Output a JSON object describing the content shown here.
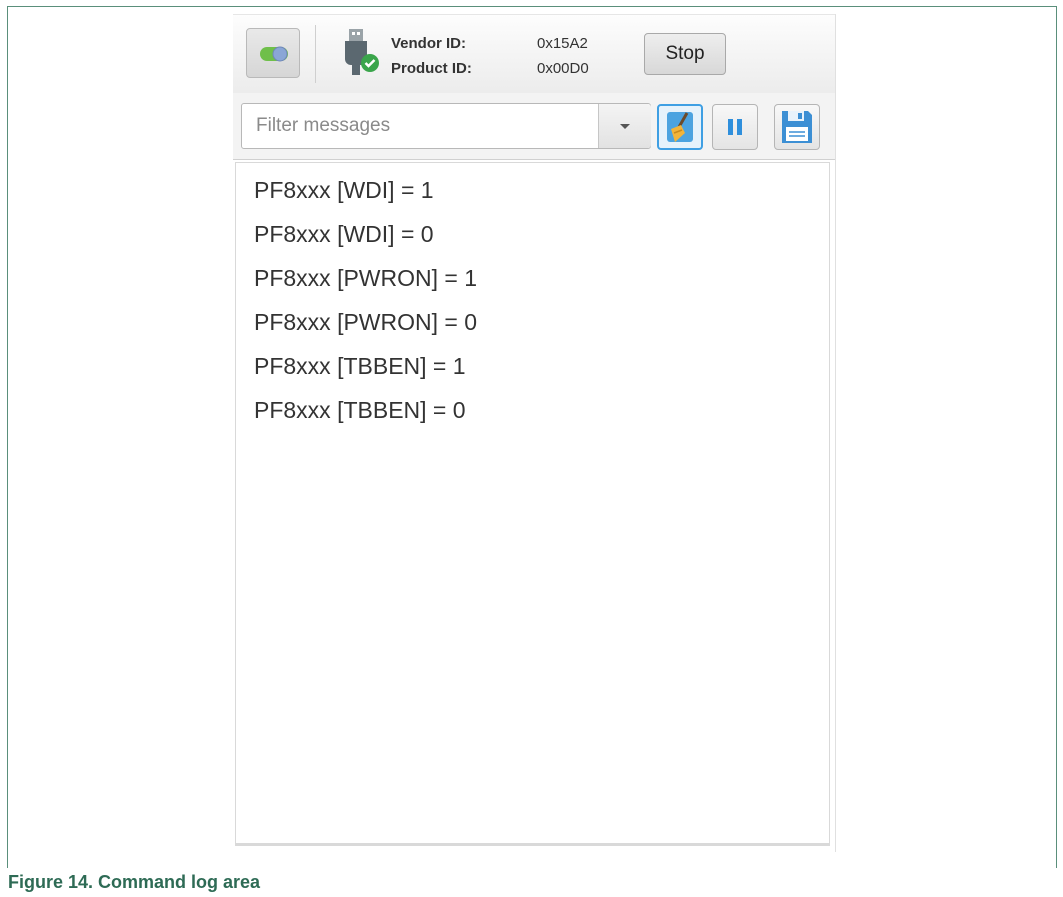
{
  "device": {
    "vendor_label": "Vendor ID:",
    "vendor_value": "0x15A2",
    "product_label": "Product ID:",
    "product_value": "0x00D0",
    "stop_label": "Stop",
    "toggle_icon": "toggle-switch-icon",
    "usb_icon": "usb-connected-icon"
  },
  "filter": {
    "placeholder": "Filter messages",
    "value": "",
    "dropdown_icon": "chevron-down-icon",
    "clear_icon": "broom-icon",
    "pause_icon": "pause-icon",
    "save_icon": "floppy-disk-icon"
  },
  "log": {
    "lines": [
      "PF8xxx [WDI] = 1",
      "PF8xxx [WDI] = 0",
      "PF8xxx [PWRON] = 1",
      "PF8xxx [PWRON] = 0",
      "PF8xxx [TBBEN] = 1",
      "PF8xxx [TBBEN] = 0"
    ]
  },
  "caption": "Figure 14.  Command log area",
  "colors": {
    "caption": "#2e6b55",
    "accent": "#3f9fe3",
    "toggle_green": "#6fbf4a"
  }
}
